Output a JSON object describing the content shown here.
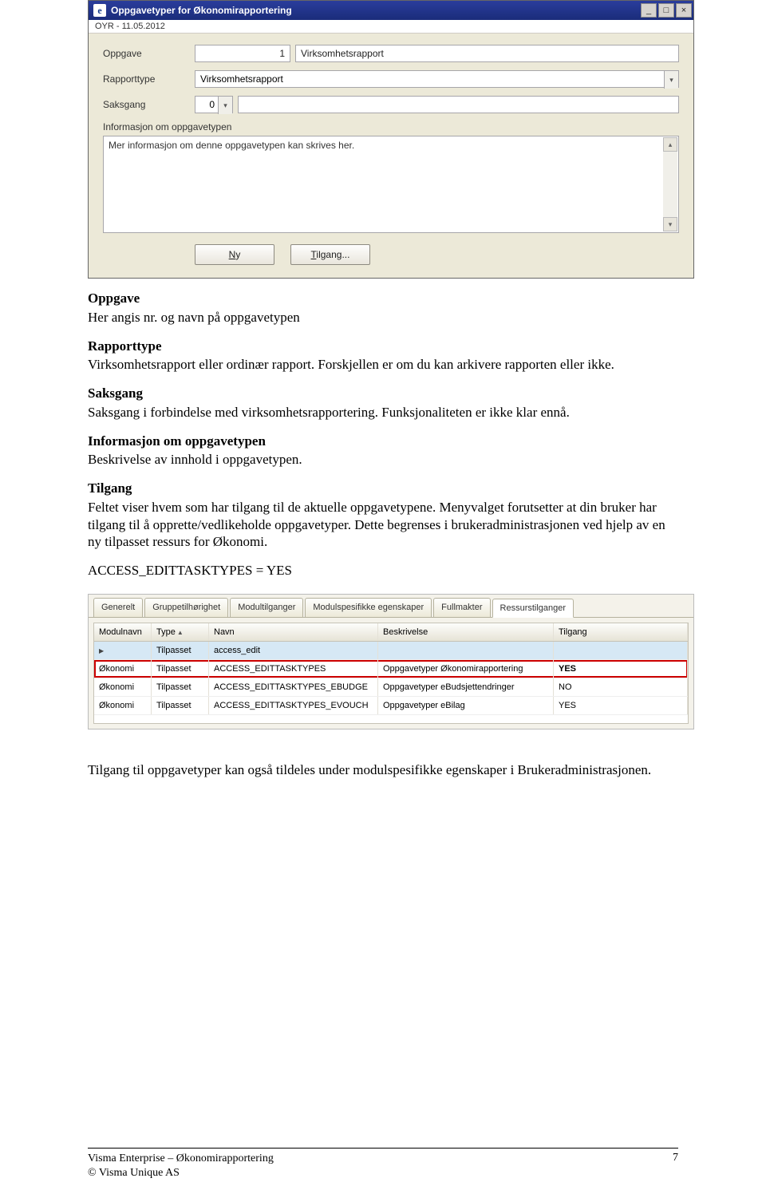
{
  "window1": {
    "title": "Oppgavetyper for Økonomirapportering",
    "subheader": "OYR - 11.05.2012",
    "labels": {
      "oppgave": "Oppgave",
      "rapporttype": "Rapporttype",
      "saksgang": "Saksgang",
      "info": "Informasjon om oppgavetypen"
    },
    "values": {
      "oppgave_num": "1",
      "oppgave_name": "Virksomhetsrapport",
      "rapporttype": "Virksomhetsrapport",
      "saksgang": "0",
      "info_text": "Mer informasjon om denne oppgavetypen kan skrives her."
    },
    "buttons": {
      "ny": "Ny",
      "tilgang": "Tilgang..."
    }
  },
  "doc": {
    "h_oppgave": "Oppgave",
    "p_oppgave": "Her angis nr. og navn på oppgavetypen",
    "h_rapport": "Rapporttype",
    "p_rapport": "Virksomhetsrapport eller ordinær rapport. Forskjellen er om du kan arkivere rapporten eller ikke.",
    "h_saksgang": "Saksgang",
    "p_saksgang": "Saksgang i forbindelse med virksomhetsrapportering. Funksjonaliteten er ikke klar ennå.",
    "h_info": "Informasjon om oppgavetypen",
    "p_info": "Beskrivelse av innhold i oppgavetypen.",
    "h_tilgang": "Tilgang",
    "p_tilgang": "Feltet viser hvem som har tilgang til de aktuelle oppgavetypene. Menyvalget forutsetter at din bruker har tilgang til å opprette/vedlikeholde oppgavetyper. Dette begrenses i brukeradministrasjonen ved hjelp av en ny tilpasset ressurs for Økonomi.",
    "access_line": "ACCESS_EDITTASKTYPES = YES",
    "p_final": "Tilgang til oppgavetyper kan også tildeles under modulspesifikke egenskaper i Brukeradministrasjonen."
  },
  "window2": {
    "tabs": [
      "Generelt",
      "Gruppetilhørighet",
      "Modultilganger",
      "Modulspesifikke egenskaper",
      "Fullmakter",
      "Ressurstilganger"
    ],
    "active_tab": "Ressurstilganger",
    "columns": [
      "Modulnavn",
      "Type",
      "Navn",
      "Beskrivelse",
      "Tilgang"
    ],
    "rows": [
      {
        "modul": "",
        "type": "Tilpasset",
        "navn": "access_edit",
        "besk": "",
        "tilg": "",
        "sel": true
      },
      {
        "modul": "Økonomi",
        "type": "Tilpasset",
        "navn": "ACCESS_EDITTASKTYPES",
        "besk": "Oppgavetyper Økonomirapportering",
        "tilg": "YES",
        "hl": true
      },
      {
        "modul": "Økonomi",
        "type": "Tilpasset",
        "navn": "ACCESS_EDITTASKTYPES_EBUDGE",
        "besk": "Oppgavetyper eBudsjettendringer",
        "tilg": "NO"
      },
      {
        "modul": "Økonomi",
        "type": "Tilpasset",
        "navn": "ACCESS_EDITTASKTYPES_EVOUCH",
        "besk": "Oppgavetyper eBilag",
        "tilg": "YES"
      }
    ]
  },
  "footer": {
    "line1": "Visma Enterprise – Økonomirapportering",
    "line2": "© Visma Unique AS",
    "page": "7"
  }
}
